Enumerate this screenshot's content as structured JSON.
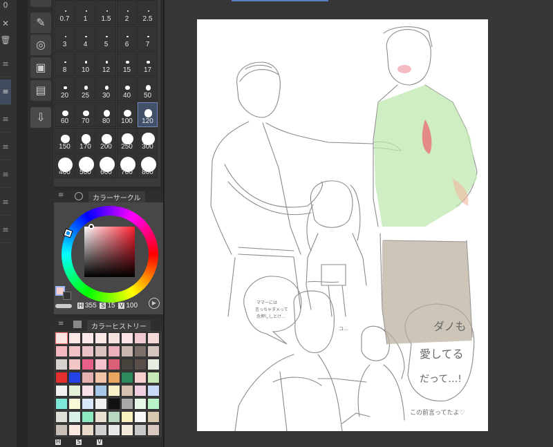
{
  "left_strip": {
    "top_value": "0",
    "tab_glyph": "≡"
  },
  "brush_panel": {
    "rows": [
      [
        "0.7",
        "1",
        "1.5",
        "2",
        "2.5"
      ],
      [
        "3",
        "4",
        "5",
        "6",
        "7"
      ],
      [
        "8",
        "10",
        "12",
        "15",
        "17"
      ],
      [
        "20",
        "25",
        "30",
        "40",
        "50"
      ],
      [
        "60",
        "70",
        "80",
        "100",
        "120"
      ],
      [
        "150",
        "170",
        "200",
        "250",
        "300"
      ],
      [
        "400",
        "500",
        "600",
        "700",
        "800"
      ]
    ],
    "selected": "120"
  },
  "color_circle": {
    "title": "カラーサークル",
    "h_label": "H",
    "h_value": "355",
    "s_label": "S",
    "s_value": "15",
    "v_label": "V",
    "v_value": "100",
    "main_color": "#f6d0cf"
  },
  "color_history": {
    "title": "カラーヒストリー",
    "footer_h": "H",
    "footer_s": "S",
    "footer_v": "V",
    "swatches": [
      "#fbe4e2",
      "#fbe8e6",
      "#fde9ea",
      "#fce8e6",
      "#f6e3e0",
      "#fbe3e6",
      "#f0c8cf",
      "#f5d8d8",
      "#f4b9c0",
      "#f1c3c6",
      "#ebc2c8",
      "#d9c2bf",
      "#ebb0bb",
      "#c9b6b0",
      "#7d6f69",
      "#d6c6c0",
      "#d8d2cd",
      "#f2c7c6",
      "#e85f8a",
      "#f4c2ce",
      "#d85f76",
      "#47433c",
      "#5a4e4a",
      "#e6ece0",
      "#e53030",
      "#2443e6",
      "#e4b0b0",
      "#f0c4a8",
      "#e7a560",
      "#2d8a5c",
      "#f6cfd0",
      "#c8e8b8",
      "#f2f2f2",
      "#e4f0d8",
      "#f8e0e8",
      "#a8c8e8",
      "#f8f0c8",
      "#d8c0b0",
      "#f0d0e0",
      "#c8d8f8",
      "#7ee8d8",
      "#f8f8d8",
      "#d8e8f8",
      "#f0f0f0",
      "#111111",
      "#a8a8a8",
      "#e8f8e8",
      "#b8f0c8",
      "#e0e0d8",
      "#d8f0e8",
      "#8ee8c0",
      "#e8e0d0",
      "#b8d8c0",
      "#f8f0c0",
      "#f8f8f8",
      "#d8c8b0",
      "#c8c0b8",
      "#f8e8e0",
      "#e8d8c8",
      "#d0d0d0",
      "#e8e8e8",
      "#f0e8d8",
      "#c8c8c8",
      "#d8c8c0"
    ]
  },
  "canvas": {
    "speech_left": [
      "ママーには",
      "言っちゃダメって",
      "念押ししとけ…"
    ],
    "speech_right": [
      "ダ",
      "ノ",
      "も",
      "愛",
      "し",
      "て",
      "る",
      "っ",
      "て"
    ],
    "speech_right_lines": [
      "ダノも",
      "愛してる",
      "だって…!"
    ],
    "caption": "この前言ってたよ♡",
    "small_sfx": "コ…"
  }
}
